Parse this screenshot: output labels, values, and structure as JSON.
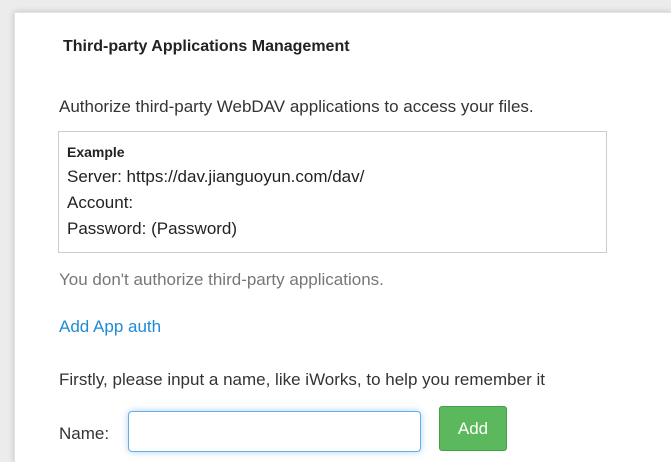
{
  "page": {
    "title": "Third-party Applications Management",
    "intro": "Authorize third-party WebDAV applications to access your files."
  },
  "example": {
    "heading": "Example",
    "server_line": "Server: https://dav.jianguoyun.com/dav/",
    "account_line": "Account:",
    "password_line": "Password: (Password)"
  },
  "status": {
    "notice": "You don't authorize third-party applications."
  },
  "actions": {
    "add_app_auth_link": "Add App auth"
  },
  "form": {
    "hint": "Firstly, please input a name, like iWorks, to help you remember it",
    "name_label": "Name:",
    "name_value": "",
    "name_placeholder": "",
    "add_button_label": "Add"
  },
  "colors": {
    "link": "#1e8bd6",
    "primary_button": "#5cb85c",
    "input_focus": "#66afe9"
  }
}
